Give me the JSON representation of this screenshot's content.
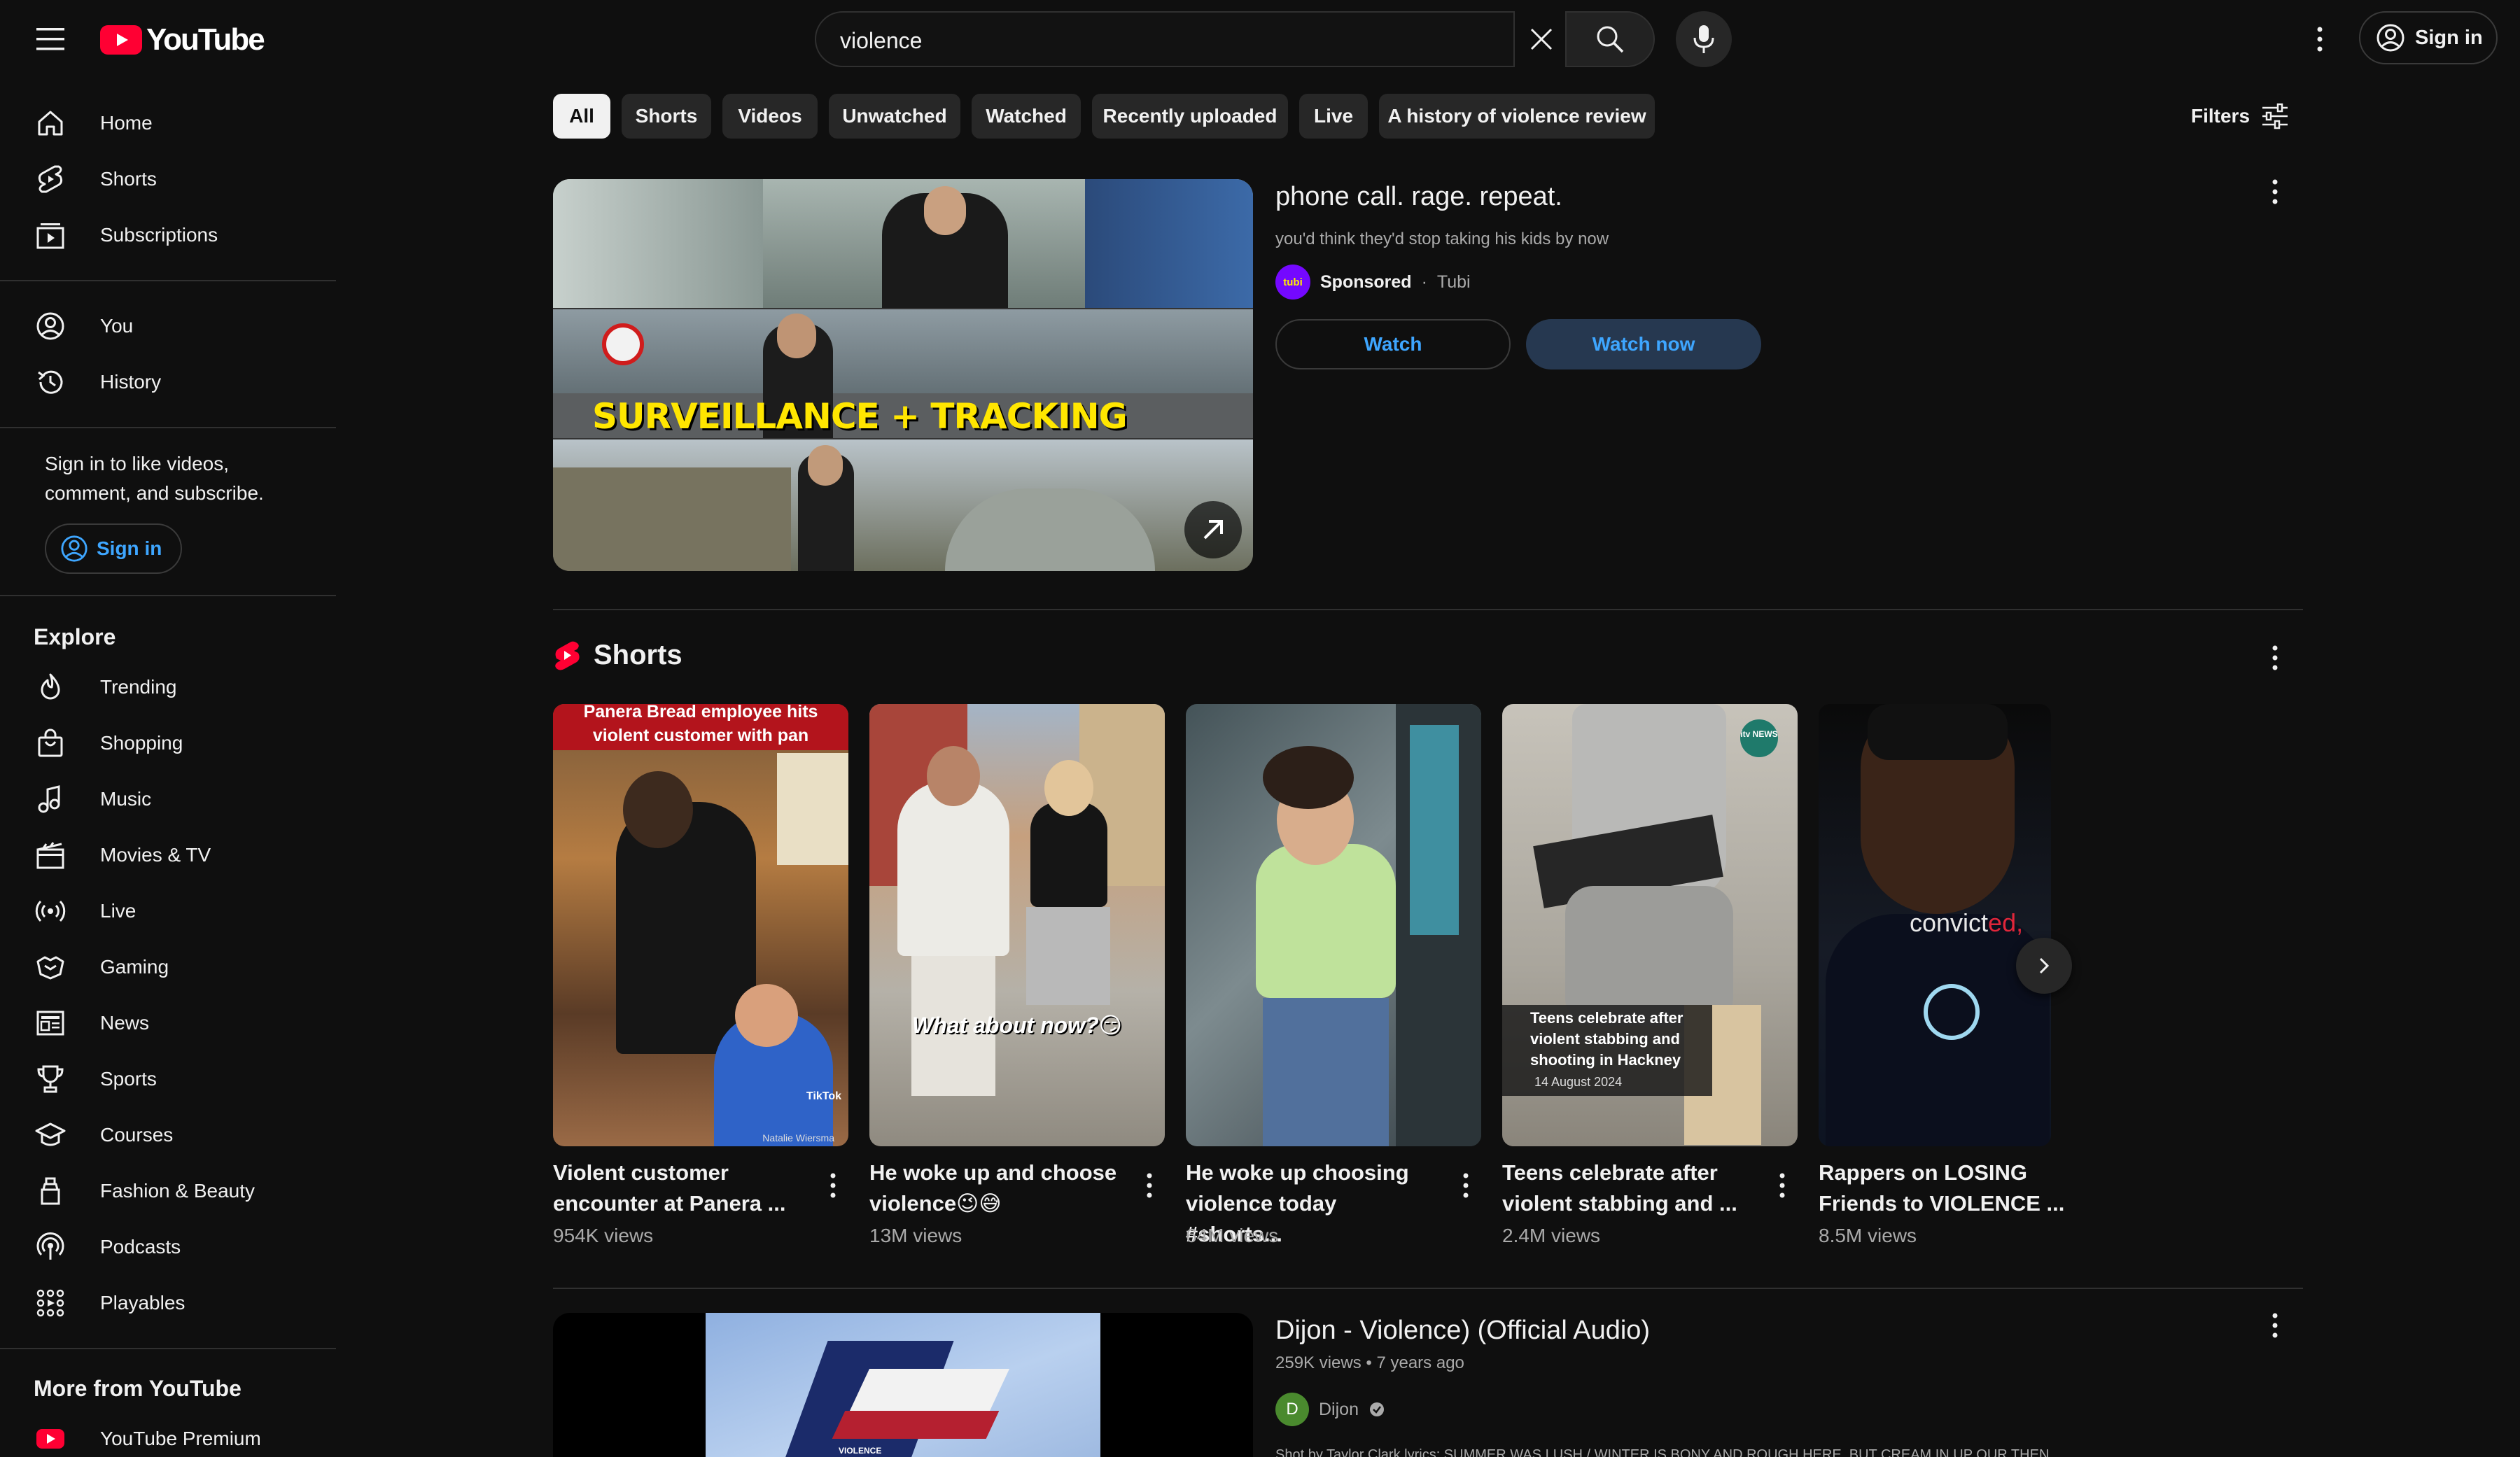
{
  "header": {
    "logo_text": "YouTube",
    "search_value": "violence",
    "signin_label": "Sign in"
  },
  "sidebar": {
    "main": [
      {
        "label": "Home",
        "icon": "home-icon"
      },
      {
        "label": "Shorts",
        "icon": "shorts-icon"
      },
      {
        "label": "Subscriptions",
        "icon": "subscriptions-icon"
      }
    ],
    "personal": [
      {
        "label": "You",
        "icon": "you-icon"
      },
      {
        "label": "History",
        "icon": "history-icon"
      }
    ],
    "signin_prompt": "Sign in to like videos, comment, and subscribe.",
    "signin_label": "Sign in",
    "explore_heading": "Explore",
    "explore": [
      {
        "label": "Trending",
        "icon": "trending-icon"
      },
      {
        "label": "Shopping",
        "icon": "shopping-icon"
      },
      {
        "label": "Music",
        "icon": "music-icon"
      },
      {
        "label": "Movies & TV",
        "icon": "movies-icon"
      },
      {
        "label": "Live",
        "icon": "live-icon"
      },
      {
        "label": "Gaming",
        "icon": "gaming-icon"
      },
      {
        "label": "News",
        "icon": "news-icon"
      },
      {
        "label": "Sports",
        "icon": "sports-icon"
      },
      {
        "label": "Courses",
        "icon": "courses-icon"
      },
      {
        "label": "Fashion & Beauty",
        "icon": "fashion-icon"
      },
      {
        "label": "Podcasts",
        "icon": "podcasts-icon"
      },
      {
        "label": "Playables",
        "icon": "playables-icon"
      }
    ],
    "more_heading": "More from YouTube",
    "more": [
      {
        "label": "YouTube Premium",
        "icon": "youtube-premium-icon"
      }
    ]
  },
  "chips": [
    "All",
    "Shorts",
    "Videos",
    "Unwatched",
    "Watched",
    "Recently uploaded",
    "Live",
    "A history of violence review"
  ],
  "filters_label": "Filters",
  "ad": {
    "title": "phone call. rage. repeat.",
    "description": "you'd think they'd stop taking his kids by now",
    "sponsored_label": "Sponsored",
    "advertiser": "Tubi",
    "advertiser_logo_text": "tubi",
    "overlay_text": "SURVEILLANCE + TRACKING",
    "watch_label": "Watch",
    "watch_now_label": "Watch now"
  },
  "shorts": {
    "heading": "Shorts",
    "items": [
      {
        "title": "Violent customer encounter at Panera ...",
        "views": "954K views",
        "caption": "Panera Bread employee hits violent customer with pan",
        "watermark": "TikTok",
        "credit": "Natalie Wiersma"
      },
      {
        "title": "He woke up and choose violence😉😅",
        "views": "13M views",
        "caption": "What about now?😏"
      },
      {
        "title": "He woke up choosing violence today #shorts...",
        "views": "64M views"
      },
      {
        "title": "Teens celebrate after violent stabbing and ...",
        "views": "2.4M views",
        "caption": "Teens celebrate after violent stabbing and shooting in Hackney",
        "date": "14 August 2024",
        "badge": "itv NEWS"
      },
      {
        "title": "Rappers on LOSING Friends to VIOLENCE ...",
        "views": "8.5M views",
        "caption_a": "convict",
        "caption_b": "ed,"
      }
    ]
  },
  "video": {
    "title": "Dijon - Violence) (Official Audio)",
    "meta": "259K views • 7 years ago",
    "channel": "Dijon",
    "channel_initial": "D",
    "thumb_text": "VIOLENCE",
    "snippet": "Shot by Taylor Clark lyrics: SUMMER WAS LUSH / WINTER IS BONY AND ROUGH HERE, BUT CREAM IN UP OUR THEN..."
  },
  "colors": {
    "background": "#0f0f0f",
    "accent_red": "#ff0033",
    "link_blue": "#3ea6ff",
    "chip_bg": "#272727"
  }
}
